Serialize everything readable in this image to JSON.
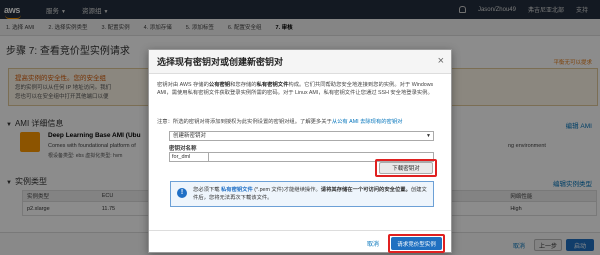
{
  "nav": {
    "logo": "aws",
    "services": "服务",
    "resource_groups": "资源组",
    "user": "Jason/Zhou49",
    "region": "弗吉尼亚北部",
    "support": "支持"
  },
  "steps": [
    "1. 选择 AMI",
    "2. 选择实例类型",
    "3. 配置实例",
    "4. 添加存储",
    "5. 添加标签",
    "6. 配置安全组",
    "7. 审核"
  ],
  "page": {
    "title": "步骤 7: 查看竞价型实例请求",
    "right_link": "平衡无可以提求",
    "warning_title": "提高实例的安全性。您的安全组",
    "warning_line1": "您的实例可以从任何 IP 地址访问。我们",
    "warning_line2": "您也可以在安全组中打开其他端口以便"
  },
  "ami_section": {
    "header": "AMI 详细信息",
    "edit": "编辑 AMI",
    "name": "Deep Learning Base AMI (Ubu",
    "desc_start": "Comes with foundational platform of",
    "desc_end": "ng environment",
    "meta": "根设备类型: ebs   虚拟化类型: hvm"
  },
  "instance_section": {
    "header": "实例类型",
    "edit": "编辑实例类型",
    "columns": [
      "实例类型",
      "ECU",
      "网络性能"
    ],
    "row": [
      "p2.xlarge",
      "11.75",
      "High"
    ]
  },
  "bottom": {
    "cancel": "取消",
    "prev": "上一步",
    "launch": "启动"
  },
  "modal": {
    "title": "选择现有密钥对或创建新密钥对",
    "desc_p1": "密钥对由 AWS 存储的",
    "desc_b1": "公有密钥",
    "desc_p2": "和您存储的",
    "desc_b2": "私有密钥文件",
    "desc_p3": "构成。它们共同帮助您安全地连接到您的实例。对于 Windows AMI，需使用私有密钥文件获取登录实例所需的密码。对于 Linux AMI，私有密钥文件让您通过 SSH 安全地登录实例。",
    "note": "注意：所选的密钥对将添加到授权为此实例设置的密钥对组。了解更多关于",
    "note_link": "从公有 AMI 去除现有的密钥对",
    "select_value": "创建新密钥对",
    "name_label": "密钥对名称",
    "name_value": "for_dml",
    "download_label": "下载密钥对",
    "info_p1": "您必须下载",
    "info_b1": "私有密钥文件",
    "info_p2": "(*.pem 文件)才能继续操作。",
    "info_b2": "请将其存储在一个可访问的安全位置。",
    "info_p3": "创建文件后，您将无法再次下载该文件。",
    "cancel": "取消",
    "launch": "请求竞价型实例"
  }
}
